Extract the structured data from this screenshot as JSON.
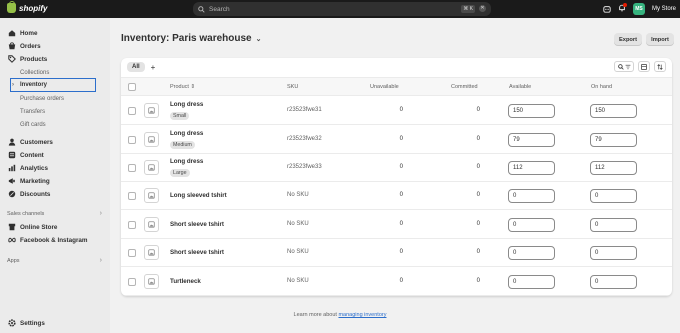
{
  "topbar": {
    "brand": "shopify",
    "search_placeholder": "Search",
    "shortcut": "⌘ K",
    "avatar_initials": "MS",
    "store_name": "My Store"
  },
  "sidebar": {
    "items": [
      {
        "label": "Home",
        "icon": "home-icon"
      },
      {
        "label": "Orders",
        "icon": "orders-icon"
      },
      {
        "label": "Products",
        "icon": "tag-icon"
      }
    ],
    "product_subitems": [
      "Collections",
      "Inventory",
      "Purchase orders",
      "Transfers",
      "Gift cards"
    ],
    "active_subitem": "Inventory",
    "items2": [
      {
        "label": "Customers",
        "icon": "person-icon"
      },
      {
        "label": "Content",
        "icon": "content-icon"
      },
      {
        "label": "Analytics",
        "icon": "chart-icon"
      },
      {
        "label": "Marketing",
        "icon": "megaphone-icon"
      },
      {
        "label": "Discounts",
        "icon": "discount-icon"
      }
    ],
    "sales_channels_heading": "Sales channels",
    "channels": [
      {
        "label": "Online Store",
        "icon": "store-icon"
      },
      {
        "label": "Facebook & Instagram",
        "icon": "meta-icon"
      }
    ],
    "apps_heading": "Apps",
    "settings_label": "Settings"
  },
  "main": {
    "title": "Inventory: Paris warehouse",
    "export_label": "Export",
    "import_label": "Import",
    "tab_all": "All",
    "columns": {
      "product": "Product",
      "sku": "SKU",
      "unavailable": "Unavailable",
      "committed": "Committed",
      "available": "Available",
      "on_hand": "On hand"
    },
    "rows": [
      {
        "name": "Long dress",
        "variant": "Small",
        "sku": "r23523fwe31",
        "unavailable": "0",
        "committed": "0",
        "available": "150",
        "on_hand": "150"
      },
      {
        "name": "Long dress",
        "variant": "Medium",
        "sku": "r23523fwe32",
        "unavailable": "0",
        "committed": "0",
        "available": "79",
        "on_hand": "79"
      },
      {
        "name": "Long dress",
        "variant": "Large",
        "sku": "r23523fwe33",
        "unavailable": "0",
        "committed": "0",
        "available": "112",
        "on_hand": "112"
      },
      {
        "name": "Long sleeved tshirt",
        "variant": "",
        "sku": "No SKU",
        "unavailable": "0",
        "committed": "0",
        "available": "0",
        "on_hand": "0"
      },
      {
        "name": "Short sleeve tshirt",
        "variant": "",
        "sku": "No SKU",
        "unavailable": "0",
        "committed": "0",
        "available": "0",
        "on_hand": "0"
      },
      {
        "name": "Short sleeve tshirt",
        "variant": "",
        "sku": "No SKU",
        "unavailable": "0",
        "committed": "0",
        "available": "0",
        "on_hand": "0"
      },
      {
        "name": "Turtleneck",
        "variant": "",
        "sku": "No SKU",
        "unavailable": "0",
        "committed": "0",
        "available": "0",
        "on_hand": "0"
      }
    ],
    "footer_text": "Learn more about ",
    "footer_link": "managing inventory"
  },
  "colors": {
    "accent": "#2c6ecb",
    "topbar": "#1a1a1a",
    "avatar": "#36b37e"
  }
}
